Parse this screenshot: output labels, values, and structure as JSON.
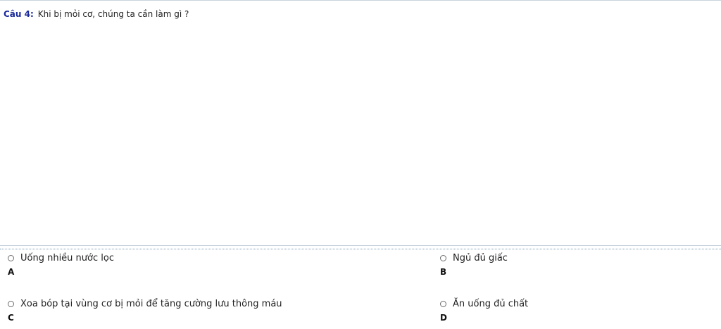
{
  "question": {
    "label": "Câu 4:",
    "text": "Khi bị mỏi cơ, chúng ta cần làm gì ?"
  },
  "options": [
    {
      "text": "Uống nhiều nước lọc",
      "letter": "A",
      "selected": false
    },
    {
      "text": "Ngủ đủ giấc",
      "letter": "B",
      "selected": false
    },
    {
      "text": "Xoa bóp tại vùng cơ bị mỏi để tăng cường lưu thông máu",
      "letter": "C",
      "selected": false
    },
    {
      "text": "Ăn uống đủ chất",
      "letter": "D",
      "selected": false
    }
  ],
  "colors": {
    "question_label": "#1a2a9c",
    "divider": "#c9d3dd",
    "dotted_divider": "#7b9cb3"
  }
}
